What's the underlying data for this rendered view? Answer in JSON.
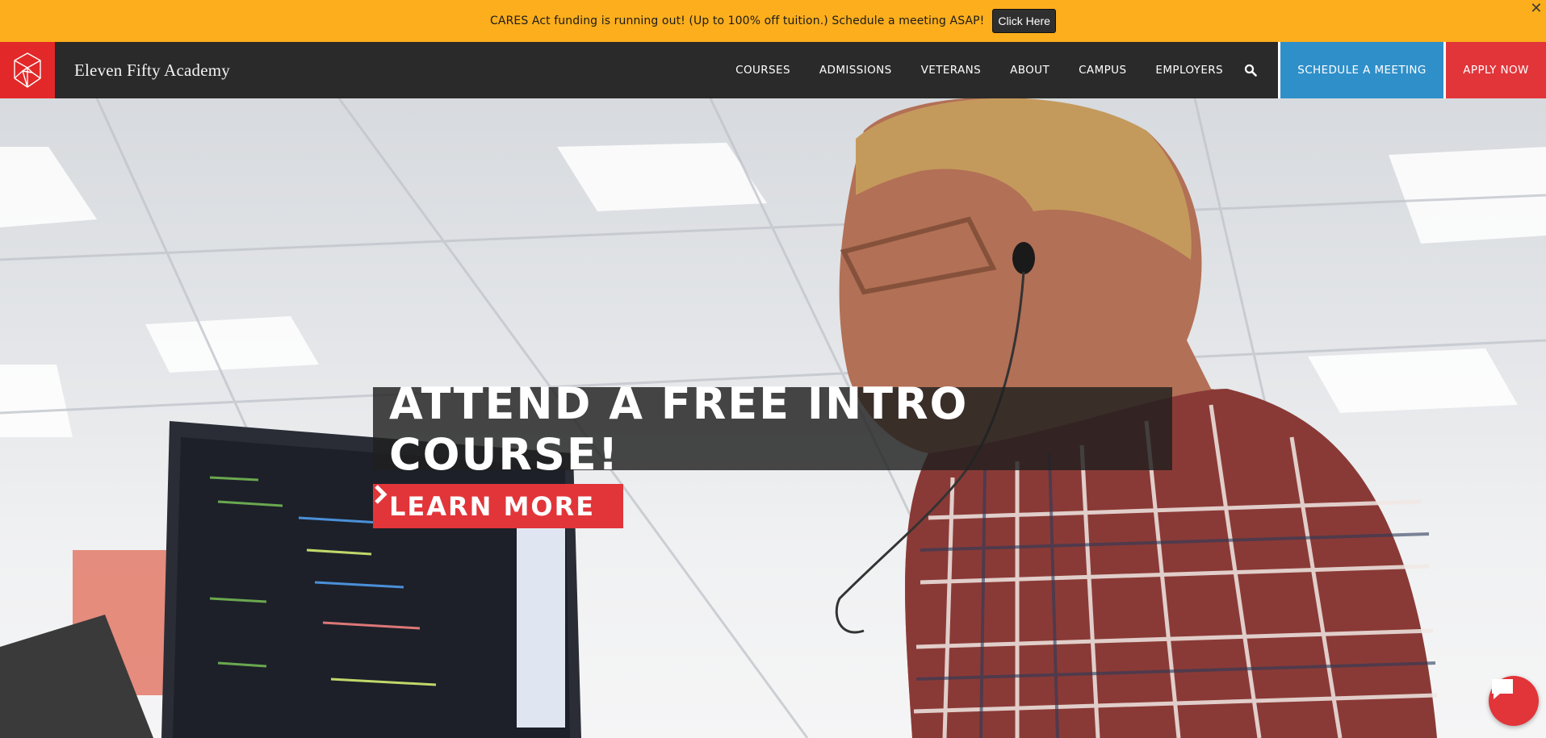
{
  "promo": {
    "text": "CARES Act funding is running out! (Up to 100% off tuition.) Schedule a meeting ASAP!",
    "button_label": "Click Here",
    "close_icon": "close-icon",
    "background_color": "#fcae1c"
  },
  "header": {
    "brand": "Eleven Fifty Academy",
    "logo_icon": "geometric-cube-logo",
    "nav": [
      {
        "label": "COURSES"
      },
      {
        "label": "ADMISSIONS"
      },
      {
        "label": "VETERANS"
      },
      {
        "label": "ABOUT"
      },
      {
        "label": "CAMPUS"
      },
      {
        "label": "EMPLOYERS"
      }
    ],
    "search_icon": "search-icon",
    "schedule_label": "SCHEDULE A MEETING",
    "apply_label": "APPLY NOW",
    "colors": {
      "nav_bg": "#2a2a2a",
      "logo_bg": "#e22828",
      "schedule_bg": "#2f8fc9",
      "apply_bg": "#e1353a"
    }
  },
  "hero": {
    "headline": "ATTEND A FREE INTRO COURSE!",
    "cta_label": "LEARN MORE",
    "cta_icon": "chevron-right-icon",
    "cta_color": "#e1353a"
  },
  "chat": {
    "icon": "chat-bubble-icon"
  }
}
